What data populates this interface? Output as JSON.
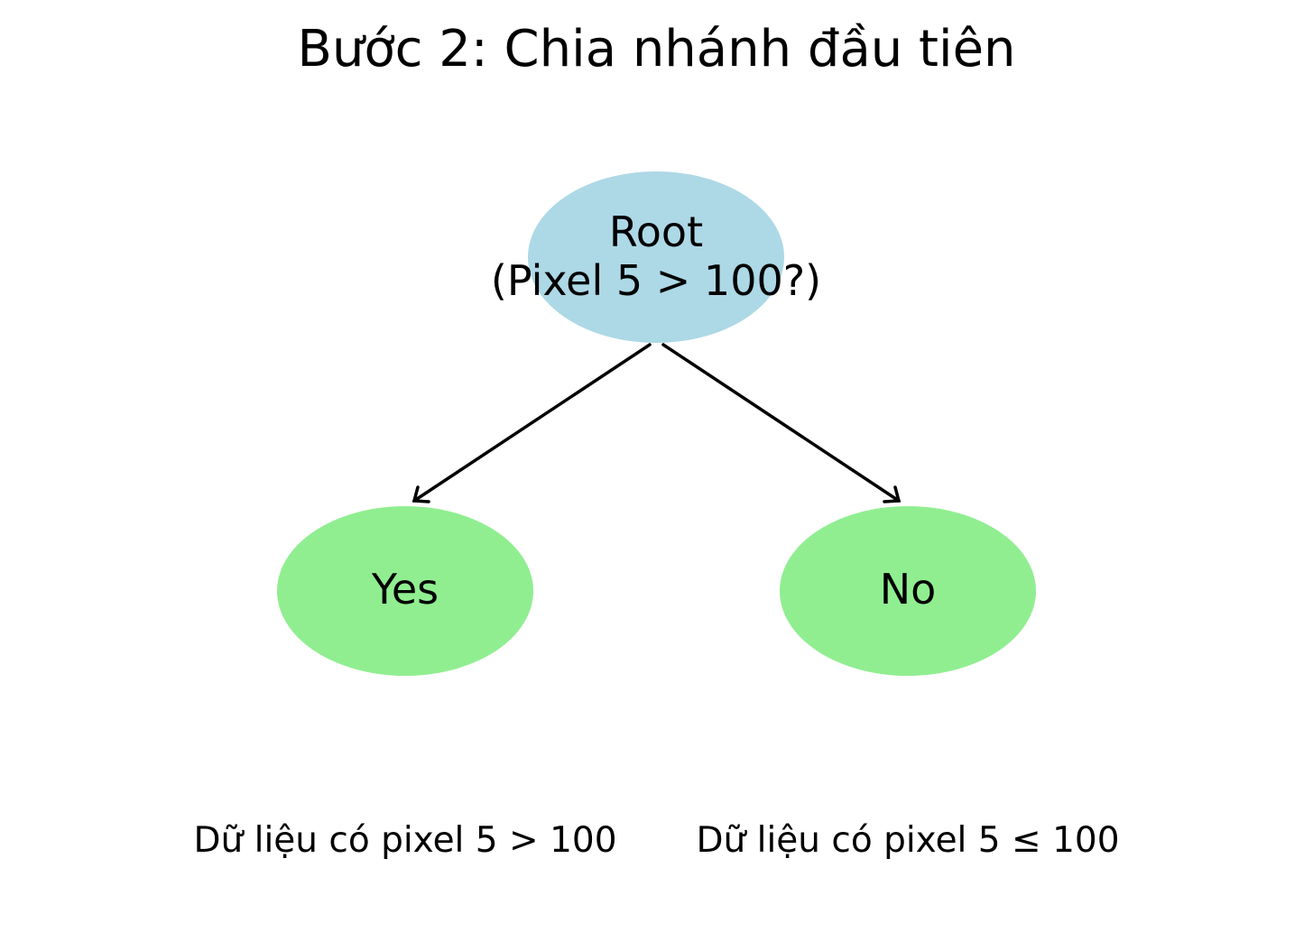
{
  "title": "Bước 2: Chia nhánh đầu tiên",
  "colors": {
    "root_fill": "#add8e6",
    "leaf_fill": "#90ee90",
    "edge": "#000000",
    "text": "#000000"
  },
  "nodes": {
    "root": {
      "line1": "Root",
      "line2": "(Pixel 5 > 100?)"
    },
    "yes": {
      "label": "Yes"
    },
    "no": {
      "label": "No"
    }
  },
  "captions": {
    "yes": "Dữ liệu có pixel 5 > 100",
    "no": "Dữ liệu có pixel 5 ≤ 100"
  }
}
